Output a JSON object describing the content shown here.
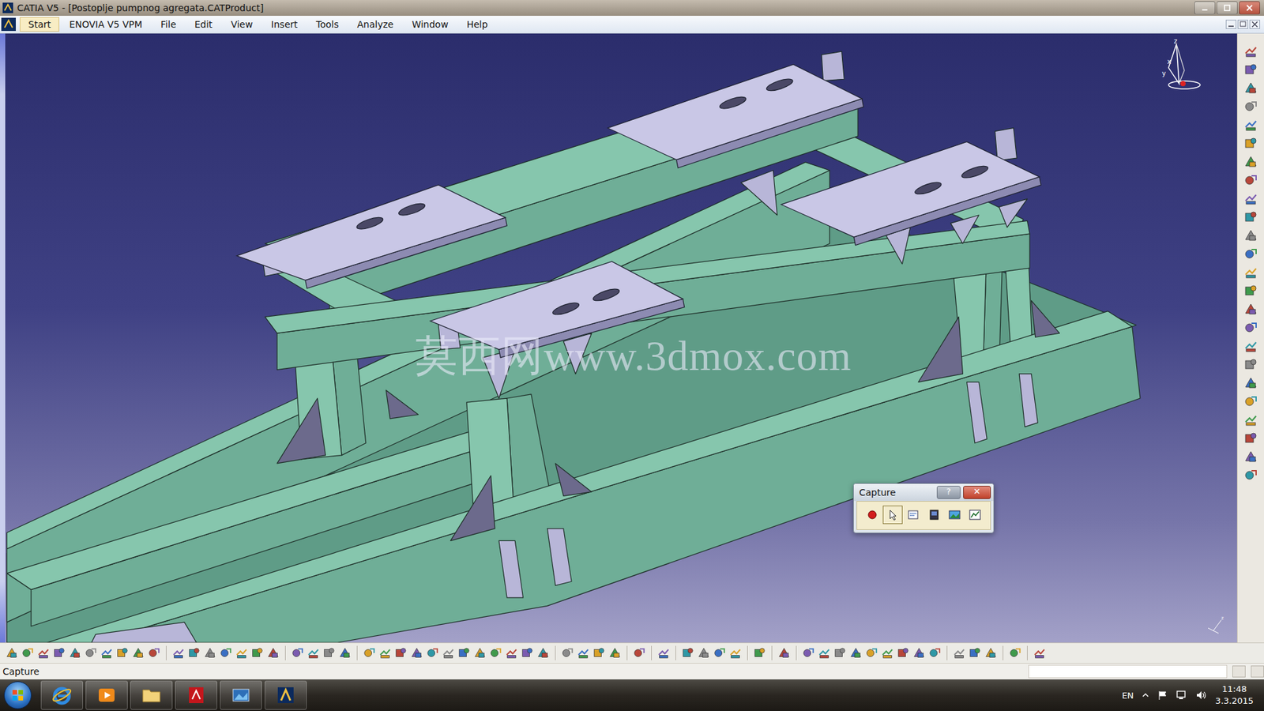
{
  "window": {
    "title": "CATIA V5 - [Postoplje pumpnog agregata.CATProduct]"
  },
  "menu": [
    {
      "label": "Start",
      "selected": true
    },
    {
      "label": "ENOVIA V5 VPM",
      "selected": false
    },
    {
      "label": "File",
      "selected": false
    },
    {
      "label": "Edit",
      "selected": false
    },
    {
      "label": "View",
      "selected": false
    },
    {
      "label": "Insert",
      "selected": false
    },
    {
      "label": "Tools",
      "selected": false
    },
    {
      "label": "Analyze",
      "selected": false
    },
    {
      "label": "Window",
      "selected": false
    },
    {
      "label": "Help",
      "selected": false
    }
  ],
  "viewport": {
    "watermark": "莫西网www.3dmox.com",
    "compass": {
      "x": "x",
      "y": "y",
      "z": "z"
    }
  },
  "capture_dialog": {
    "title": "Capture",
    "help": "?",
    "close": "✕"
  },
  "status_bar": {
    "text": "Capture"
  },
  "taskbar": {
    "language": "EN",
    "time": "11:48",
    "date": "3.3.2015"
  }
}
